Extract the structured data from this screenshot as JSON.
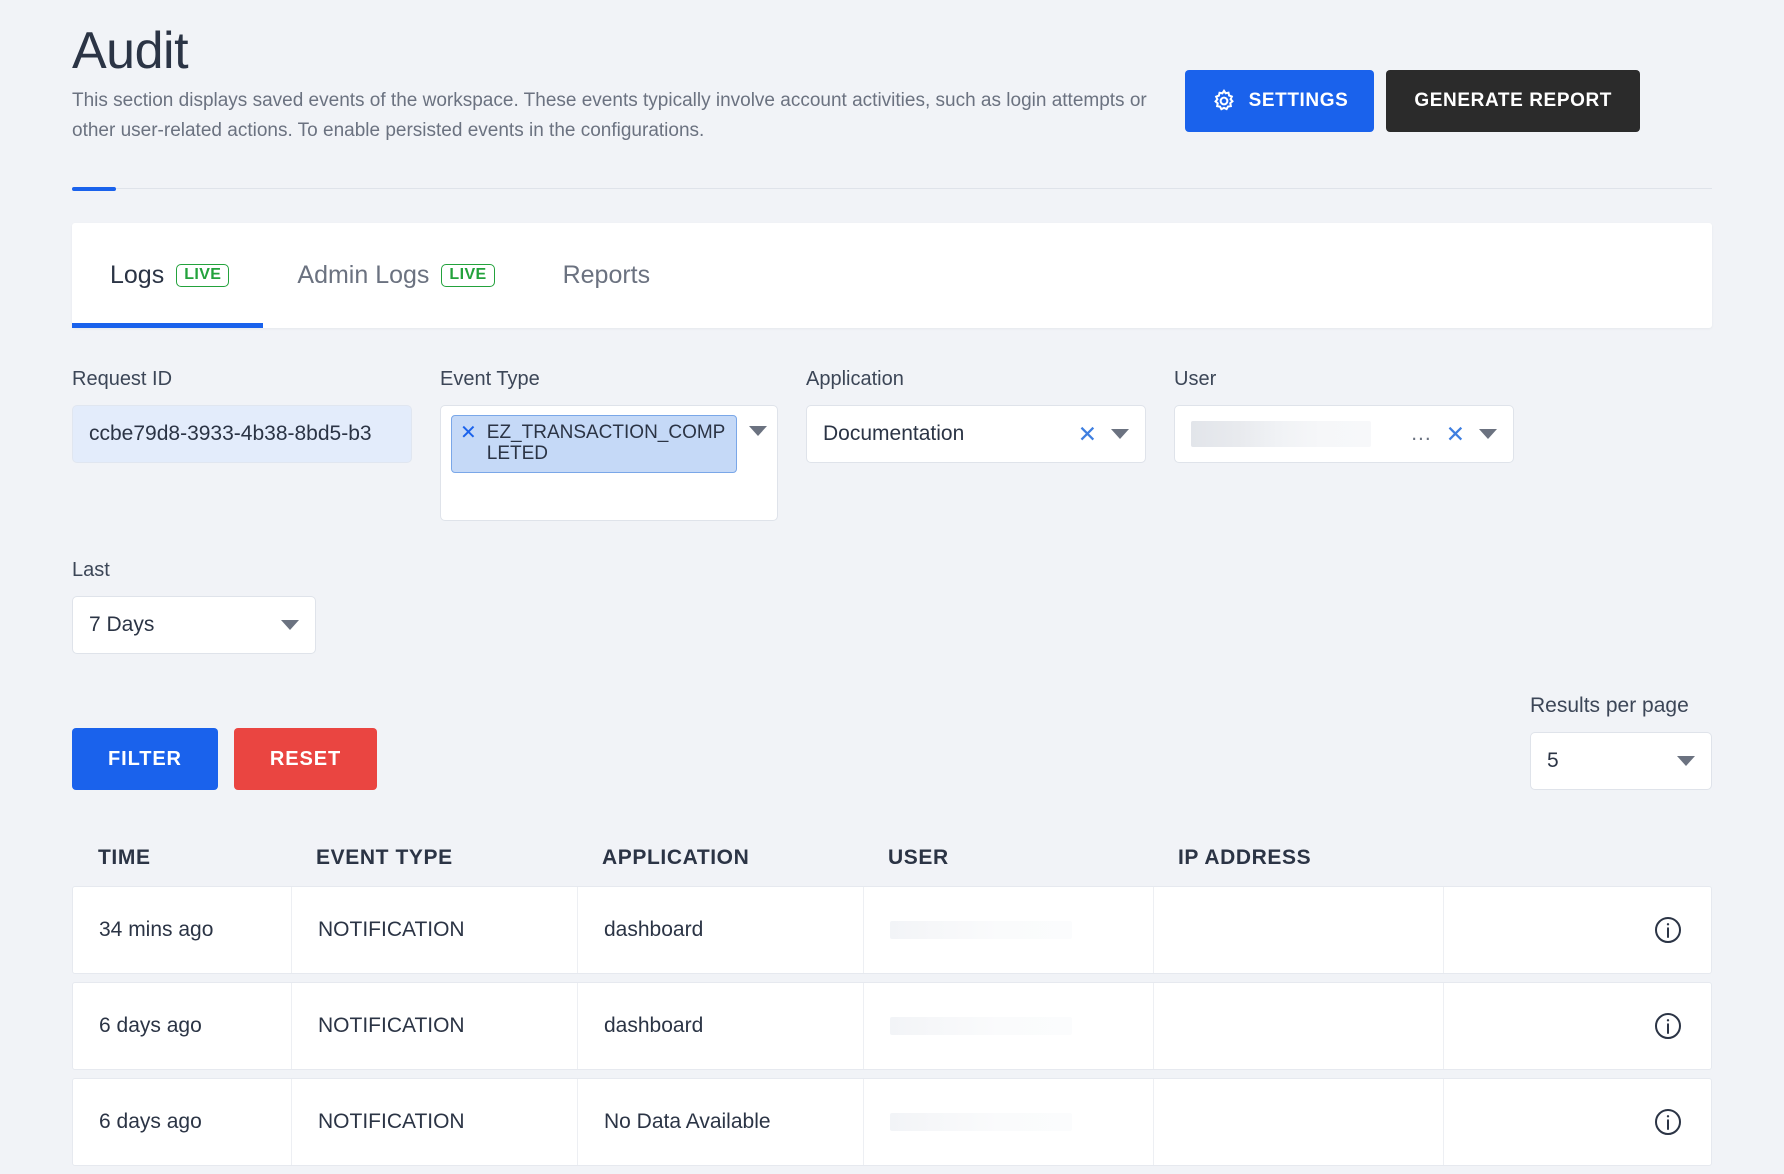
{
  "header": {
    "title": "Audit",
    "description": "This section displays saved events of the workspace. These events typically involve account activities, such as login attempts or other user-related actions. To enable persisted events in the configurations.",
    "settings_label": "SETTINGS",
    "generate_label": "GENERATE REPORT",
    "settings_icon": "gear-icon"
  },
  "colors": {
    "accent_blue": "#1a62ec",
    "dark_button": "#2b2b2b",
    "reset_red": "#ea4541",
    "live_green": "#23a23c",
    "page_bg": "#f1f3f7"
  },
  "tabs": [
    {
      "label": "Logs",
      "badge": "LIVE",
      "active": true
    },
    {
      "label": "Admin Logs",
      "badge": "LIVE",
      "active": false
    },
    {
      "label": "Reports",
      "badge": "",
      "active": false
    }
  ],
  "filters": {
    "request_id": {
      "label": "Request ID",
      "value": "ccbe79d8-3933-4b38-8bd5-b3"
    },
    "event_type": {
      "label": "Event Type",
      "chip": "EZ_TRANSACTION_COMPLETED"
    },
    "application": {
      "label": "Application",
      "value": "Documentation"
    },
    "user": {
      "label": "User",
      "value": "",
      "ellipsis": "..."
    },
    "last": {
      "label": "Last",
      "value": "7 Days"
    }
  },
  "actions": {
    "filter_label": "FILTER",
    "reset_label": "RESET"
  },
  "results_per_page": {
    "label": "Results per page",
    "value": "5"
  },
  "table": {
    "columns": [
      "TIME",
      "EVENT TYPE",
      "APPLICATION",
      "USER",
      "IP ADDRESS"
    ],
    "rows": [
      {
        "time": "34 mins ago",
        "event_type": "NOTIFICATION",
        "application": "dashboard",
        "user": "",
        "ip": ""
      },
      {
        "time": "6 days ago",
        "event_type": "NOTIFICATION",
        "application": "dashboard",
        "user": "",
        "ip": ""
      },
      {
        "time": "6 days ago",
        "event_type": "NOTIFICATION",
        "application": "No Data Available",
        "user": "",
        "ip": ""
      }
    ]
  }
}
